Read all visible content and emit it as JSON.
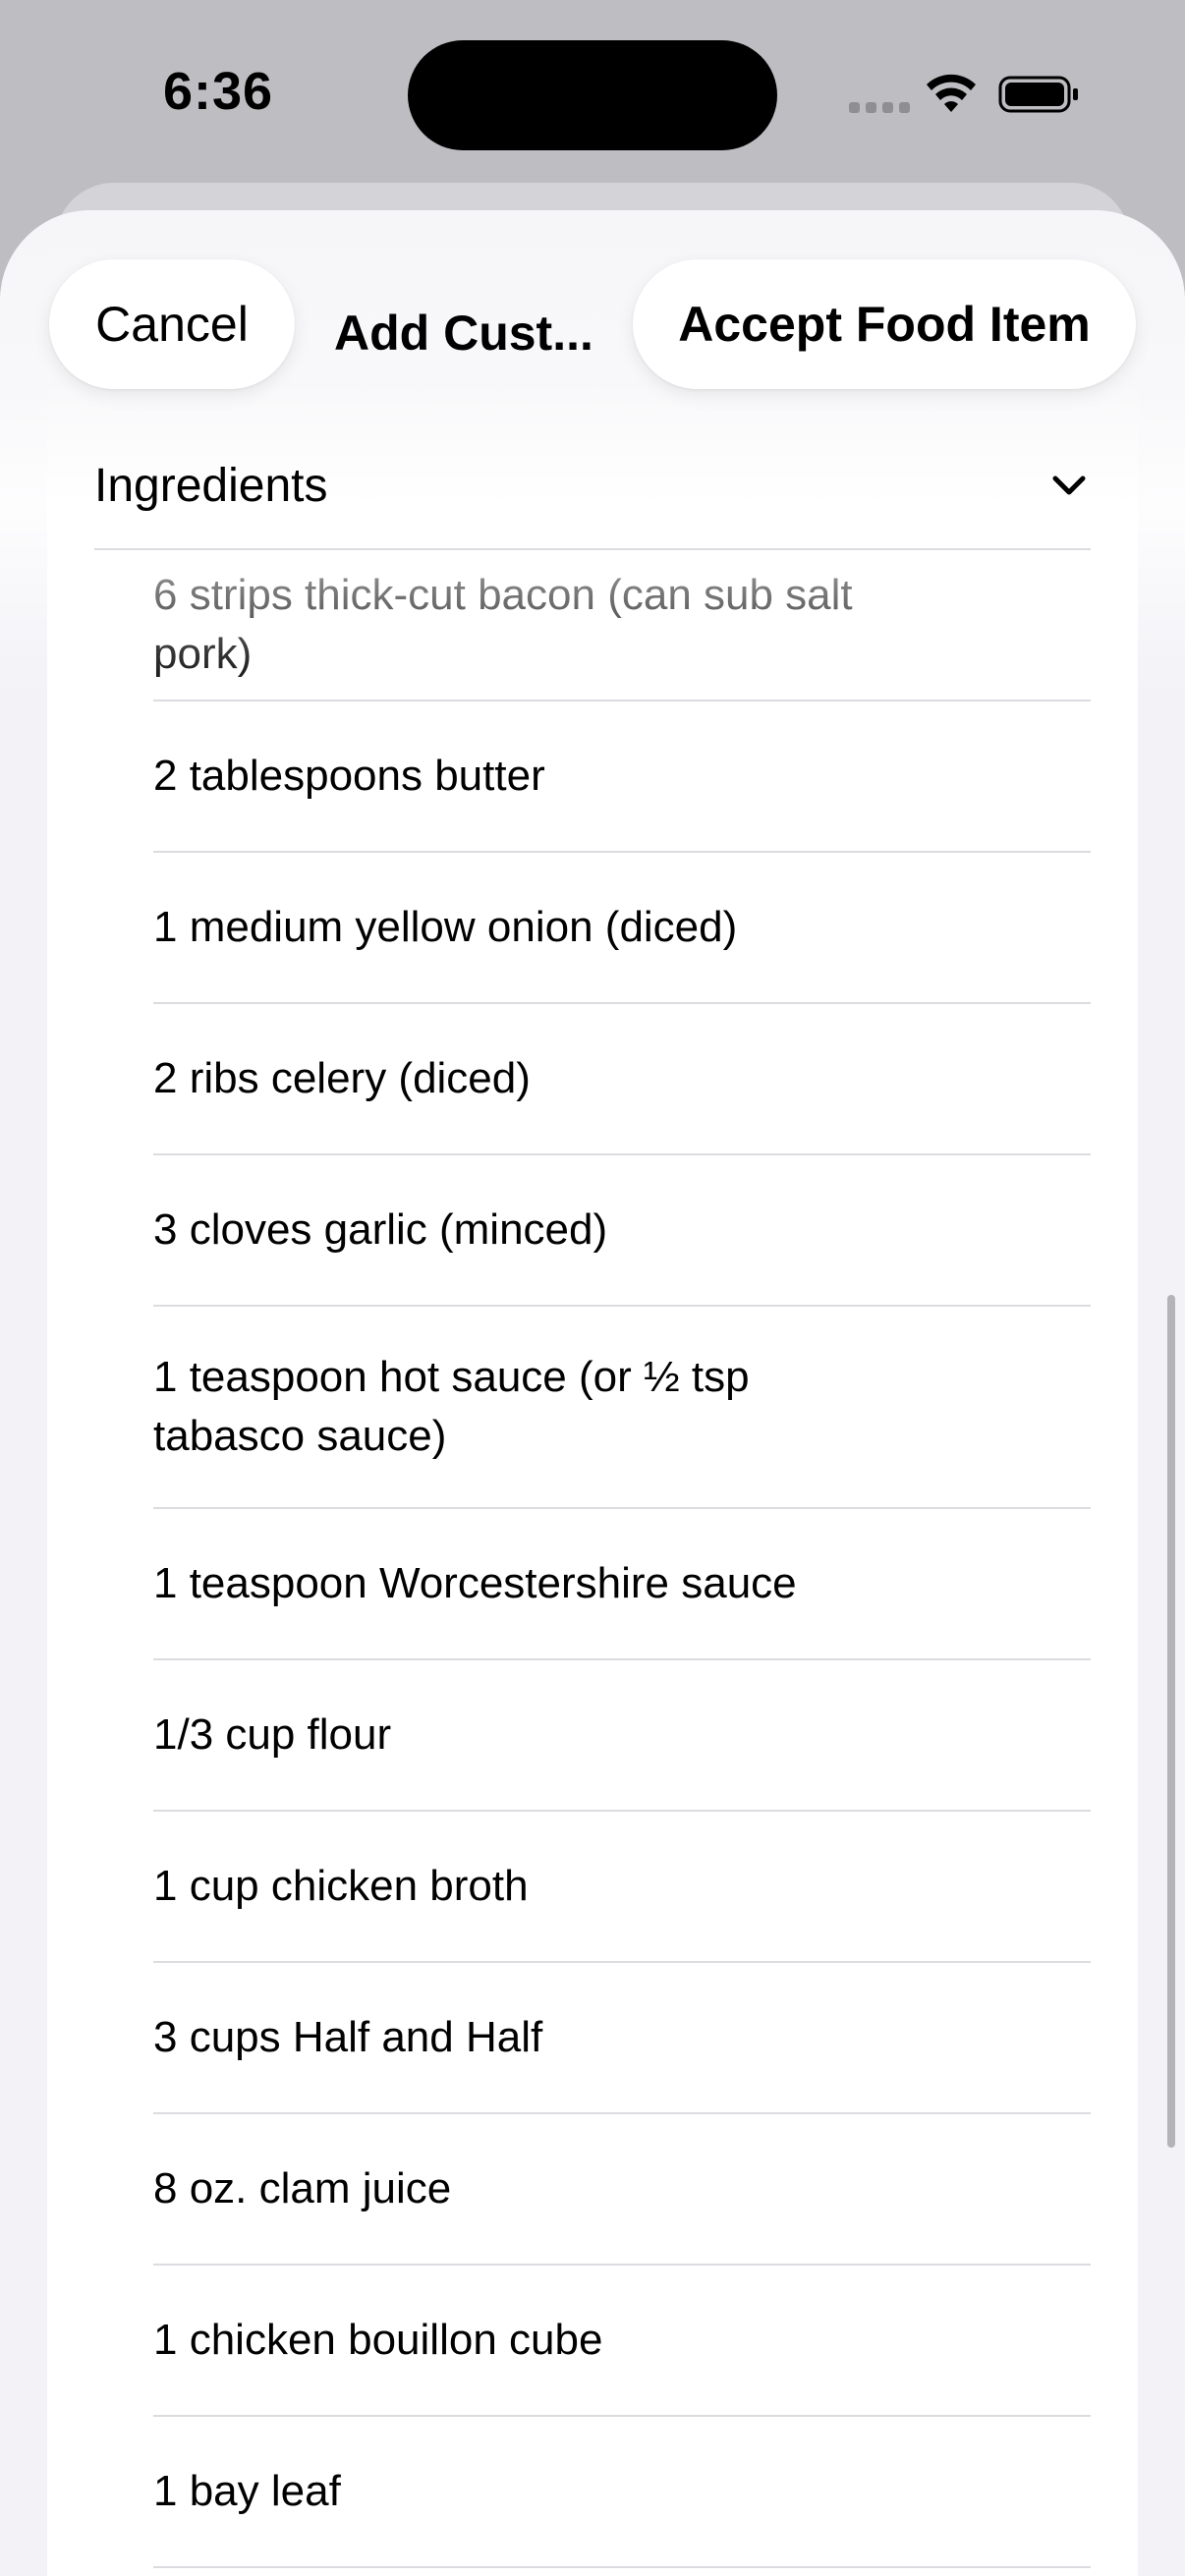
{
  "status_bar": {
    "time": "6:36"
  },
  "nav": {
    "cancel_label": "Cancel",
    "title": "Add Cust...",
    "accept_label": "Accept Food Item"
  },
  "section": {
    "title": "Ingredients",
    "chevron_icon": "chevron-down-icon"
  },
  "ingredients": [
    "6  strips thick-cut bacon (can sub salt pork)",
    "2 tablespoons butter",
    "1  medium yellow onion (diced)",
    "2 ribs celery (diced)",
    "3 cloves garlic (minced)",
    "1 teaspoon hot sauce (or ½ tsp tabasco sauce)",
    "1 teaspoon Worcestershire sauce",
    "1/3 cup flour",
    "1 cup chicken broth",
    "3 cups Half and Half",
    "8 oz. clam juice",
    "1  chicken bouillon cube",
    "1  bay leaf"
  ],
  "colors": {
    "sheet_background": "#f2f2f7",
    "card_background": "#ffffff",
    "divider": "#dcdce0",
    "text": "#000000"
  }
}
